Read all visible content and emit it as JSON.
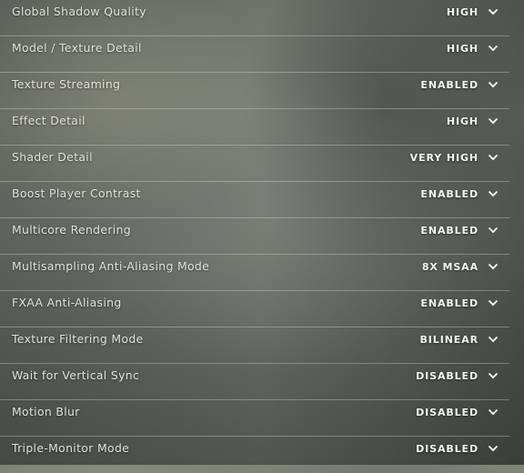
{
  "settings": [
    {
      "label": "Global Shadow Quality",
      "value": "HIGH",
      "icon": "chevron-down-icon"
    },
    {
      "label": "Model / Texture Detail",
      "value": "HIGH",
      "icon": "chevron-down-icon"
    },
    {
      "label": "Texture Streaming",
      "value": "ENABLED",
      "icon": "chevron-down-icon"
    },
    {
      "label": "Effect Detail",
      "value": "HIGH",
      "icon": "chevron-down-icon"
    },
    {
      "label": "Shader Detail",
      "value": "VERY HIGH",
      "icon": "chevron-down-icon"
    },
    {
      "label": "Boost Player Contrast",
      "value": "ENABLED",
      "icon": "chevron-down-icon"
    },
    {
      "label": "Multicore Rendering",
      "value": "ENABLED",
      "icon": "chevron-down-icon"
    },
    {
      "label": "Multisampling Anti-Aliasing Mode",
      "value": "8X MSAA",
      "icon": "chevron-down-icon"
    },
    {
      "label": "FXAA Anti-Aliasing",
      "value": "ENABLED",
      "icon": "chevron-down-icon"
    },
    {
      "label": "Texture Filtering Mode",
      "value": "BILINEAR",
      "icon": "chevron-down-icon"
    },
    {
      "label": "Wait for Vertical Sync",
      "value": "DISABLED",
      "icon": "chevron-down-icon"
    },
    {
      "label": "Motion Blur",
      "value": "DISABLED",
      "icon": "chevron-down-icon"
    },
    {
      "label": "Triple-Monitor Mode",
      "value": "DISABLED",
      "icon": "chevron-down-icon"
    }
  ],
  "colors": {
    "label": "#e2e2dc",
    "value": "#f4f4f0",
    "divider": "#ebebe6"
  }
}
